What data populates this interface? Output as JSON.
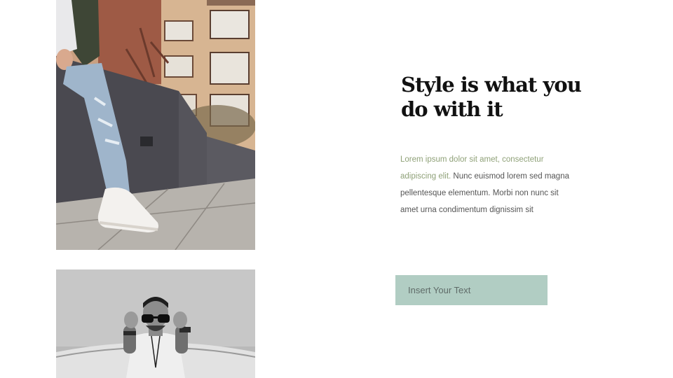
{
  "slide": {
    "headline": "Style is what you do with it",
    "body_accent": "Lorem  ipsum dolor sit amet, consectetur adipiscing elit.",
    "body_rest": " Nunc euismod lorem sed magna pellentesque elementum.  Morbi non nunc sit amet urna condimentum  dignissim sit",
    "cta_label": "Insert Your Text"
  },
  "colors": {
    "accent_text": "#8fa178",
    "cta_background": "#b1cdc3",
    "headline": "#111111",
    "body": "#555555"
  },
  "images": {
    "top": "photo-man-sneakers-street",
    "bottom": "photo-man-sunglasses-bw"
  }
}
